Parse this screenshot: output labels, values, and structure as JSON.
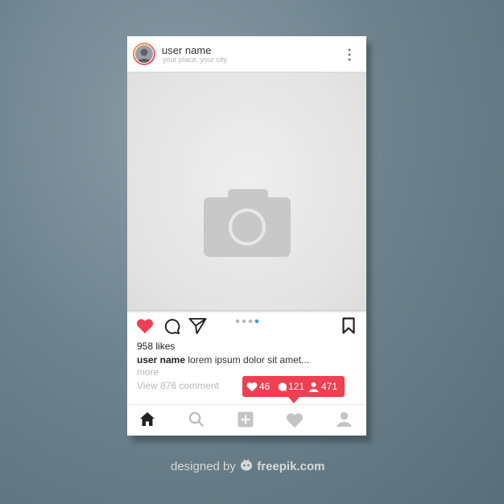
{
  "post": {
    "username": "user name",
    "location": "your place, your city",
    "likes": "958 likes",
    "caption_user": "user name",
    "caption_text": "lorem ipsum dolor sit amet...",
    "more": "more",
    "comments": "View 876 comment"
  },
  "notification": {
    "likes_count": "46",
    "comments_count": "121",
    "followers_count": "471"
  },
  "carousel": {
    "dots": 4,
    "active_index": 3
  },
  "nav": [
    "home-icon",
    "search-icon",
    "add-post-icon",
    "activity-heart-icon",
    "profile-icon"
  ],
  "credit": {
    "prefix": "designed by",
    "brand": "freepik.com"
  },
  "colors": {
    "like_red": "#ef3f52",
    "avatar_ring_start": "#f9a43a",
    "avatar_ring_end": "#e93a6a",
    "carousel_active": "#3897f0",
    "background": "#6f838e"
  }
}
